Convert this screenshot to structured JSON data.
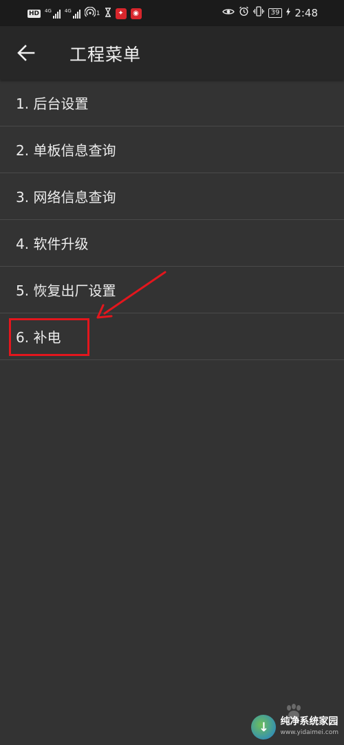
{
  "status_bar": {
    "hd_label": "HD",
    "sim1_label": "4G",
    "sim2_label": "4G",
    "hotspot_count": "1",
    "battery": "39",
    "time": "2:48"
  },
  "toolbar": {
    "title": "工程菜单"
  },
  "menu": {
    "items": [
      {
        "label": "1. 后台设置"
      },
      {
        "label": "2. 单板信息查询"
      },
      {
        "label": "3. 网络信息查询"
      },
      {
        "label": "4. 软件升级"
      },
      {
        "label": "5. 恢复出厂设置"
      },
      {
        "label": "6. 补电"
      }
    ]
  },
  "watermark": {
    "name": "纯净系统家园",
    "url": "www.yidaimei.com"
  },
  "colors": {
    "background": "#333333",
    "toolbar": "#272727",
    "annotation": "#e3161d"
  }
}
